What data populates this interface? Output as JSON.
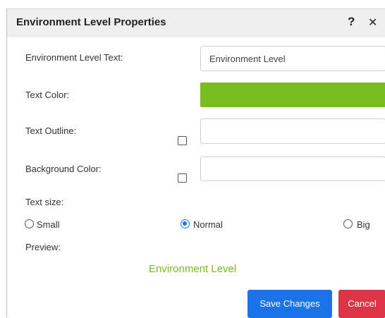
{
  "dialog": {
    "title": "Environment Level Properties",
    "help_glyph": "?",
    "close_glyph": "✕"
  },
  "fields": {
    "level_text_label": "Environment Level Text:",
    "level_text_value": "Environment Level",
    "text_color_label": "Text Color:",
    "text_color_value": "#78bc1f",
    "text_outline_label": "Text Outline:",
    "text_outline_checked": false,
    "text_outline_value": "",
    "background_color_label": "Background Color:",
    "background_color_checked": false,
    "background_color_value": ""
  },
  "text_size": {
    "label": "Text size:",
    "options": [
      {
        "label": "Small",
        "checked": false
      },
      {
        "label": "Normal",
        "checked": true
      },
      {
        "label": "Big",
        "checked": false
      }
    ]
  },
  "preview": {
    "label": "Preview:",
    "text": "Environment Level",
    "color": "#78bc1f"
  },
  "buttons": {
    "save_label": "Save Changes",
    "save_color": "#1a73e8",
    "cancel_label": "Cancel",
    "cancel_color": "#dc3545"
  }
}
